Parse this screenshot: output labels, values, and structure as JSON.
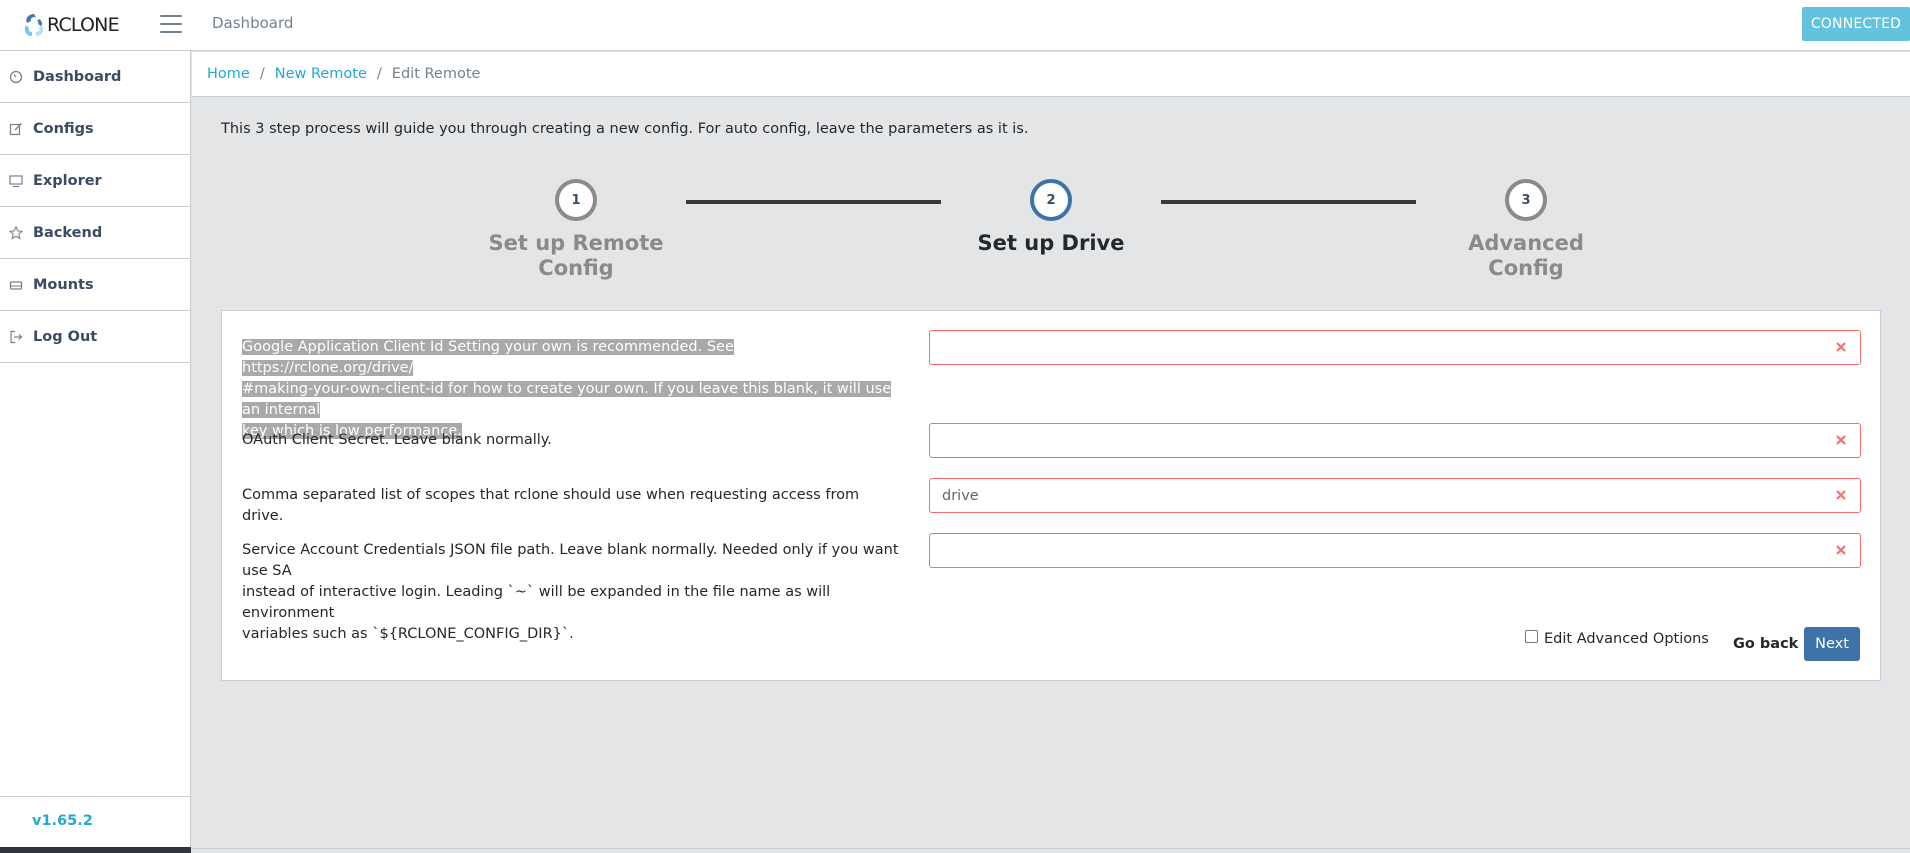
{
  "app": {
    "logo_text": "RCLONE",
    "header_title": "Dashboard",
    "status_badge": "CONNECTED",
    "version": "v1.65.2"
  },
  "sidebar": {
    "items": [
      {
        "label": "Dashboard",
        "icon": "speedometer-icon"
      },
      {
        "label": "Configs",
        "icon": "pencil-square-icon"
      },
      {
        "label": "Explorer",
        "icon": "monitor-icon"
      },
      {
        "label": "Backend",
        "icon": "star-icon"
      },
      {
        "label": "Mounts",
        "icon": "drive-icon"
      },
      {
        "label": "Log Out",
        "icon": "logout-icon"
      }
    ]
  },
  "breadcrumb": {
    "items": [
      "Home",
      "New Remote"
    ],
    "current": "Edit Remote"
  },
  "intro_text": "This 3 step process will guide you through creating a new config. For auto config, leave the parameters as it is.",
  "steps": [
    {
      "number": "1",
      "label_line1": "Set up Remote",
      "label_line2": "Config"
    },
    {
      "number": "2",
      "label_line1": "Set up Drive",
      "label_line2": ""
    },
    {
      "number": "3",
      "label_line1": "Advanced",
      "label_line2": "Config"
    }
  ],
  "fields": [
    {
      "label_lines": [
        "Google Application Client Id Setting your own is recommended. See https://rclone.org/drive/",
        "#making-your-own-client-id for how to create your own. If you leave this blank, it will use an internal",
        "key which is low performance."
      ],
      "value": ""
    },
    {
      "label_lines": [
        "OAuth Client Secret. Leave blank normally."
      ],
      "value": ""
    },
    {
      "label_lines": [
        "Comma separated list of scopes that rclone should use when requesting access from drive."
      ],
      "value": "drive"
    },
    {
      "label_lines": [
        "Service Account Credentials JSON file path. Leave blank normally. Needed only if you want use SA",
        "instead of interactive login. Leading `~` will be expanded in the file name as will environment",
        "variables such as `${RCLONE_CONFIG_DIR}`."
      ],
      "value": ""
    }
  ],
  "actions": {
    "edit_advanced_label": "Edit Advanced Options",
    "go_back_label": "Go back",
    "next_label": "Next"
  },
  "colors": {
    "accent": "#20a8d8",
    "badge": "#63c2de",
    "primary": "#3d73a8",
    "danger": "#f86c6b"
  }
}
